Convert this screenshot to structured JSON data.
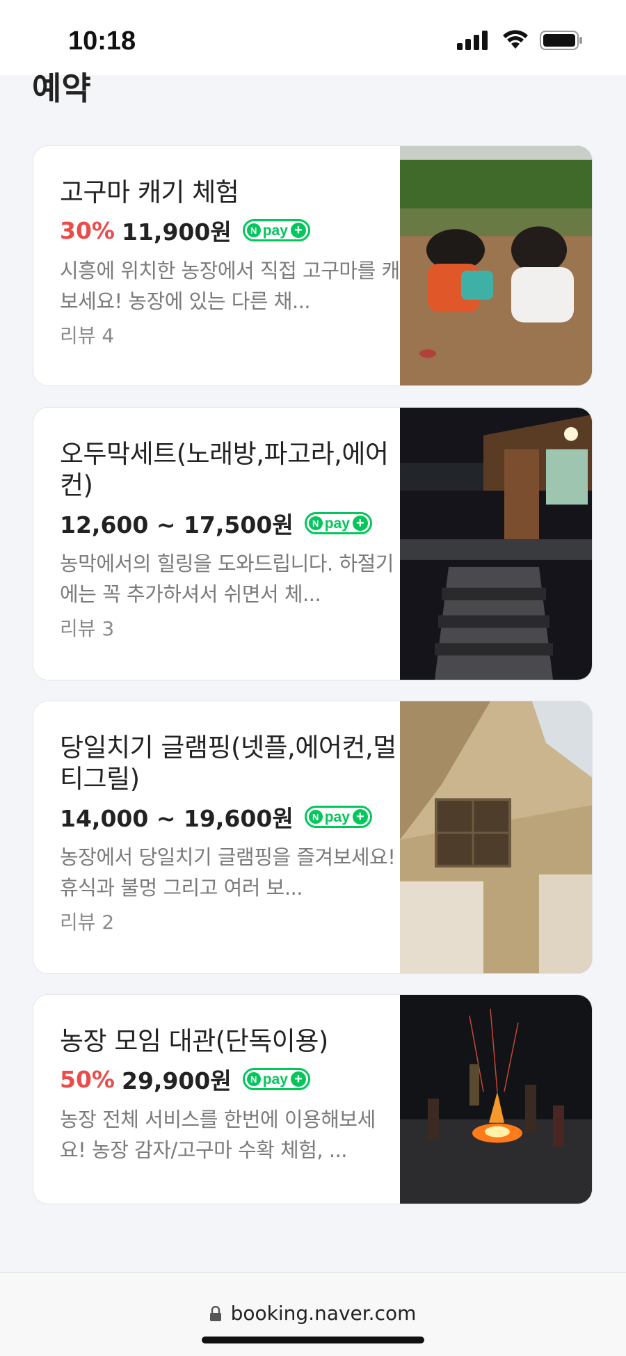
{
  "status_bar": {
    "time": "10:18"
  },
  "section_title": "예약",
  "products": [
    {
      "title": "고구마 캐기 체험",
      "discount": "30%",
      "price": "11,900원",
      "npay": "pay",
      "description": "시흥에 위치한 농장에서 직접 고구마를 캐보세요! 농장에 있는 다른 채...",
      "review": "리뷰 4",
      "image": "children-digging-sweet-potatoes"
    },
    {
      "title": "오두막세트(노래방,파고라,에어컨)",
      "price": "12,600 ~ 17,500원",
      "npay": "pay",
      "description": "농막에서의 힐링을 도와드립니다. 하절기에는 꼭 추가하셔서 쉬면서 체...",
      "review": "리뷰 3",
      "image": "wooden-cabin-at-night"
    },
    {
      "title": "당일치기 글램핑(넷플,에어컨,멀티그릴)",
      "price": "14,000 ~ 19,600원",
      "npay": "pay",
      "description": "농장에서 당일치기 글램핑을 즐겨보세요! 휴식과 불멍 그리고 여러 보...",
      "review": "리뷰 2",
      "image": "glamping-tent-interior"
    },
    {
      "title": "농장 모임 대관(단독이용)",
      "discount": "50%",
      "price": "29,900원",
      "npay": "pay",
      "description": "농장 전체 서비스를 한번에 이용해보세요! 농장 감자/고구마 수확 체험, ...",
      "image": "campfire-at-night"
    }
  ],
  "browser": {
    "url": "booking.naver.com"
  },
  "colors": {
    "discount": "#ea4b4b",
    "npay": "#03c75a"
  }
}
